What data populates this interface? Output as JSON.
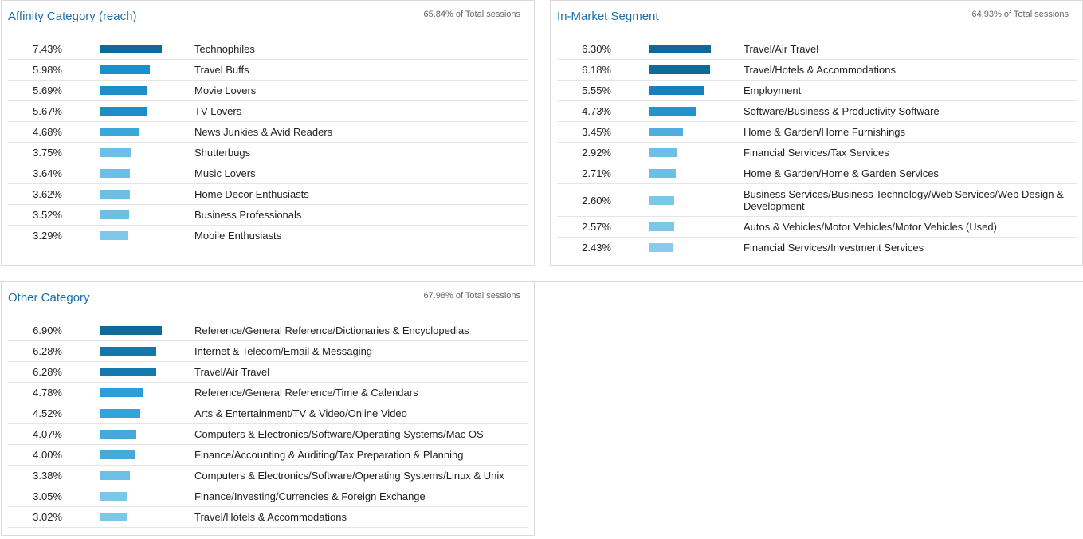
{
  "panels": [
    {
      "id": "affinity",
      "title": "Affinity Category (reach)",
      "total": "65.84% of Total sessions",
      "rows": [
        {
          "pct": "7.43%",
          "label": "Technophiles",
          "value": 7.43,
          "color": "#0f6a99"
        },
        {
          "pct": "5.98%",
          "label": "Travel Buffs",
          "value": 5.98,
          "color": "#1c8fcb"
        },
        {
          "pct": "5.69%",
          "label": "Movie Lovers",
          "value": 5.69,
          "color": "#1c8fcb"
        },
        {
          "pct": "5.67%",
          "label": "TV Lovers",
          "value": 5.67,
          "color": "#1c8fcb"
        },
        {
          "pct": "4.68%",
          "label": "News Junkies & Avid Readers",
          "value": 4.68,
          "color": "#3aa7da"
        },
        {
          "pct": "3.75%",
          "label": "Shutterbugs",
          "value": 3.75,
          "color": "#6dbfe5"
        },
        {
          "pct": "3.64%",
          "label": "Music Lovers",
          "value": 3.64,
          "color": "#6dbfe5"
        },
        {
          "pct": "3.62%",
          "label": "Home Decor Enthusiasts",
          "value": 3.62,
          "color": "#6dbfe5"
        },
        {
          "pct": "3.52%",
          "label": "Business Professionals",
          "value": 3.52,
          "color": "#6dbfe5"
        },
        {
          "pct": "3.29%",
          "label": "Mobile Enthusiasts",
          "value": 3.29,
          "color": "#80c8e9"
        }
      ]
    },
    {
      "id": "inmarket",
      "title": "In-Market Segment",
      "total": "64.93% of Total sessions",
      "rows": [
        {
          "pct": "6.30%",
          "label": "Travel/Air Travel",
          "value": 6.3,
          "color": "#0f6a99"
        },
        {
          "pct": "6.18%",
          "label": "Travel/Hotels & Accommodations",
          "value": 6.18,
          "color": "#0f6a99"
        },
        {
          "pct": "5.55%",
          "label": "Employment",
          "value": 5.55,
          "color": "#1781bd"
        },
        {
          "pct": "4.73%",
          "label": "Software/Business & Productivity Software",
          "value": 4.73,
          "color": "#2393cd"
        },
        {
          "pct": "3.45%",
          "label": "Home & Garden/Home Furnishings",
          "value": 3.45,
          "color": "#4faedd"
        },
        {
          "pct": "2.92%",
          "label": "Financial Services/Tax Services",
          "value": 2.92,
          "color": "#6dbfe5"
        },
        {
          "pct": "2.71%",
          "label": "Home & Garden/Home & Garden Services",
          "value": 2.71,
          "color": "#6dbfe5"
        },
        {
          "pct": "2.60%",
          "label": "Business Services/Business Technology/Web Services/Web Design & Development",
          "value": 2.6,
          "color": "#7cc6e8",
          "tall": true
        },
        {
          "pct": "2.57%",
          "label": "Autos & Vehicles/Motor Vehicles/Motor Vehicles (Used)",
          "value": 2.57,
          "color": "#7cc6e8"
        },
        {
          "pct": "2.43%",
          "label": "Financial Services/Investment Services",
          "value": 2.43,
          "color": "#86cbea"
        }
      ]
    },
    {
      "id": "other",
      "title": "Other Category",
      "total": "67.98% of Total sessions",
      "rows": [
        {
          "pct": "6.90%",
          "label": "Reference/General Reference/Dictionaries & Encyclopedias",
          "value": 6.9,
          "color": "#0f6a99"
        },
        {
          "pct": "6.28%",
          "label": "Internet & Telecom/Email & Messaging",
          "value": 6.28,
          "color": "#1278ae"
        },
        {
          "pct": "6.28%",
          "label": "Travel/Air Travel",
          "value": 6.28,
          "color": "#1278ae"
        },
        {
          "pct": "4.78%",
          "label": "Reference/General Reference/Time & Calendars",
          "value": 4.78,
          "color": "#2e9fd6"
        },
        {
          "pct": "4.52%",
          "label": "Arts & Entertainment/TV & Video/Online Video",
          "value": 4.52,
          "color": "#33a3d8"
        },
        {
          "pct": "4.07%",
          "label": "Computers & Electronics/Software/Operating Systems/Mac OS",
          "value": 4.07,
          "color": "#45aadb"
        },
        {
          "pct": "4.00%",
          "label": "Finance/Accounting & Auditing/Tax Preparation & Planning",
          "value": 4.0,
          "color": "#45aadb"
        },
        {
          "pct": "3.38%",
          "label": "Computers & Electronics/Software/Operating Systems/Linux & Unix",
          "value": 3.38,
          "color": "#6dbfe5"
        },
        {
          "pct": "3.05%",
          "label": "Finance/Investing/Currencies & Foreign Exchange",
          "value": 3.05,
          "color": "#7cc6e8"
        },
        {
          "pct": "3.02%",
          "label": "Travel/Hotels & Accommodations",
          "value": 3.02,
          "color": "#7cc6e8"
        }
      ]
    }
  ]
}
